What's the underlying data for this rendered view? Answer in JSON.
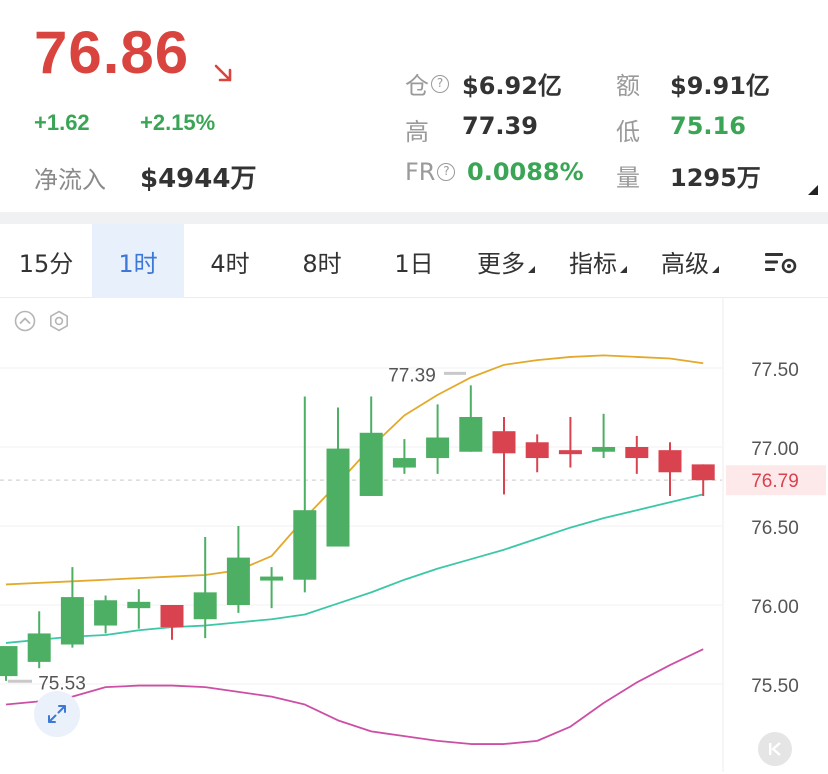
{
  "quote": {
    "price": "76.86",
    "change_abs": "+1.62",
    "change_pct": "+2.15%",
    "netflow_label": "净流入",
    "netflow_value": "$4944万",
    "price_color": "#d9443f",
    "up_color": "#3aa655"
  },
  "stats": {
    "open_interest_label": "仓",
    "open_interest_value": "$6.92亿",
    "volume_amount_label": "额",
    "volume_amount_value": "$9.91亿",
    "high_label": "高",
    "high_value": "77.39",
    "low_label": "低",
    "low_value": "75.16",
    "funding_rate_label": "FR",
    "funding_rate_value": "0.0088%",
    "volume_label": "量",
    "volume_value": "1295万",
    "help_glyph": "?"
  },
  "tabs": [
    {
      "label": "15分",
      "active": false
    },
    {
      "label": "1时",
      "active": true
    },
    {
      "label": "4时",
      "active": false
    },
    {
      "label": "8时",
      "active": false
    },
    {
      "label": "1日",
      "active": false
    },
    {
      "label": "更多",
      "active": false,
      "dropdown": true
    },
    {
      "label": "指标",
      "active": false,
      "dropdown": true
    },
    {
      "label": "高级",
      "active": false,
      "dropdown": true
    }
  ],
  "icons": {
    "arrow": "arrow-down-right-icon",
    "settings": "chart-settings-icon",
    "collapse": "collapse-up-icon",
    "indicator_settings": "hexagon-settings-icon",
    "zoom": "expand-icon",
    "k_jump": "jump-to-latest-icon"
  },
  "chart_data": {
    "type": "candlestick",
    "y_ticks": [
      "77.50",
      "77.00",
      "76.50",
      "76.00",
      "75.50"
    ],
    "current_price_label": "76.79",
    "current_price": 76.79,
    "high_marker": "77.39",
    "low_marker": "75.53",
    "ylim": [
      75.35,
      77.78
    ],
    "up_color": "#4caf63",
    "down_color": "#d9434f",
    "candles": [
      {
        "o": 75.55,
        "h": 75.72,
        "l": 75.52,
        "c": 75.74,
        "dir": "up"
      },
      {
        "o": 75.64,
        "h": 75.96,
        "l": 75.6,
        "c": 75.82,
        "dir": "up"
      },
      {
        "o": 75.75,
        "h": 76.24,
        "l": 75.73,
        "c": 76.05,
        "dir": "up"
      },
      {
        "o": 75.87,
        "h": 76.06,
        "l": 75.82,
        "c": 76.03,
        "dir": "up"
      },
      {
        "o": 75.98,
        "h": 76.1,
        "l": 75.85,
        "c": 76.02,
        "dir": "up"
      },
      {
        "o": 76.0,
        "h": 76.0,
        "l": 75.78,
        "c": 75.86,
        "dir": "down"
      },
      {
        "o": 75.91,
        "h": 76.43,
        "l": 75.79,
        "c": 76.08,
        "dir": "up"
      },
      {
        "o": 76.0,
        "h": 76.5,
        "l": 75.95,
        "c": 76.3,
        "dir": "up"
      },
      {
        "o": 76.16,
        "h": 76.24,
        "l": 75.98,
        "c": 76.18,
        "dir": "up"
      },
      {
        "o": 76.16,
        "h": 77.32,
        "l": 76.08,
        "c": 76.6,
        "dir": "up"
      },
      {
        "o": 76.37,
        "h": 77.25,
        "l": 76.37,
        "c": 76.99,
        "dir": "up"
      },
      {
        "o": 76.69,
        "h": 77.32,
        "l": 76.69,
        "c": 77.09,
        "dir": "up"
      },
      {
        "o": 76.87,
        "h": 77.05,
        "l": 76.83,
        "c": 76.93,
        "dir": "up"
      },
      {
        "o": 76.93,
        "h": 77.27,
        "l": 76.83,
        "c": 77.06,
        "dir": "up"
      },
      {
        "o": 76.97,
        "h": 77.39,
        "l": 76.97,
        "c": 77.19,
        "dir": "up"
      },
      {
        "o": 77.1,
        "h": 77.19,
        "l": 76.7,
        "c": 76.96,
        "dir": "down"
      },
      {
        "o": 77.03,
        "h": 77.08,
        "l": 76.84,
        "c": 76.93,
        "dir": "down"
      },
      {
        "o": 76.98,
        "h": 77.19,
        "l": 76.87,
        "c": 76.97,
        "dir": "down"
      },
      {
        "o": 77.0,
        "h": 77.21,
        "l": 76.93,
        "c": 76.97,
        "dir": "up"
      },
      {
        "o": 77.0,
        "h": 77.07,
        "l": 76.83,
        "c": 76.93,
        "dir": "down"
      },
      {
        "o": 76.98,
        "h": 77.03,
        "l": 76.69,
        "c": 76.84,
        "dir": "down"
      },
      {
        "o": 76.89,
        "h": 76.89,
        "l": 76.69,
        "c": 76.79,
        "dir": "down"
      }
    ],
    "bands": {
      "upper": [
        76.13,
        76.14,
        76.15,
        76.16,
        76.17,
        76.18,
        76.19,
        76.22,
        76.31,
        76.55,
        76.77,
        77.0,
        77.2,
        77.33,
        77.44,
        77.52,
        77.55,
        77.57,
        77.58,
        77.57,
        77.56,
        77.53
      ],
      "middle": [
        75.76,
        75.78,
        75.8,
        75.81,
        75.84,
        75.86,
        75.87,
        75.89,
        75.91,
        75.94,
        76.01,
        76.08,
        76.16,
        76.23,
        76.29,
        76.35,
        76.42,
        76.49,
        76.55,
        76.6,
        76.65,
        76.7
      ],
      "lower": [
        75.37,
        75.39,
        75.42,
        75.48,
        75.49,
        75.49,
        75.48,
        75.45,
        75.42,
        75.37,
        75.27,
        75.2,
        75.17,
        75.14,
        75.12,
        75.12,
        75.14,
        75.23,
        75.38,
        75.51,
        75.62,
        75.72
      ]
    },
    "band_colors": {
      "upper": "#e3a92a",
      "middle": "#3cc7a7",
      "lower": "#cc4fa5"
    }
  }
}
